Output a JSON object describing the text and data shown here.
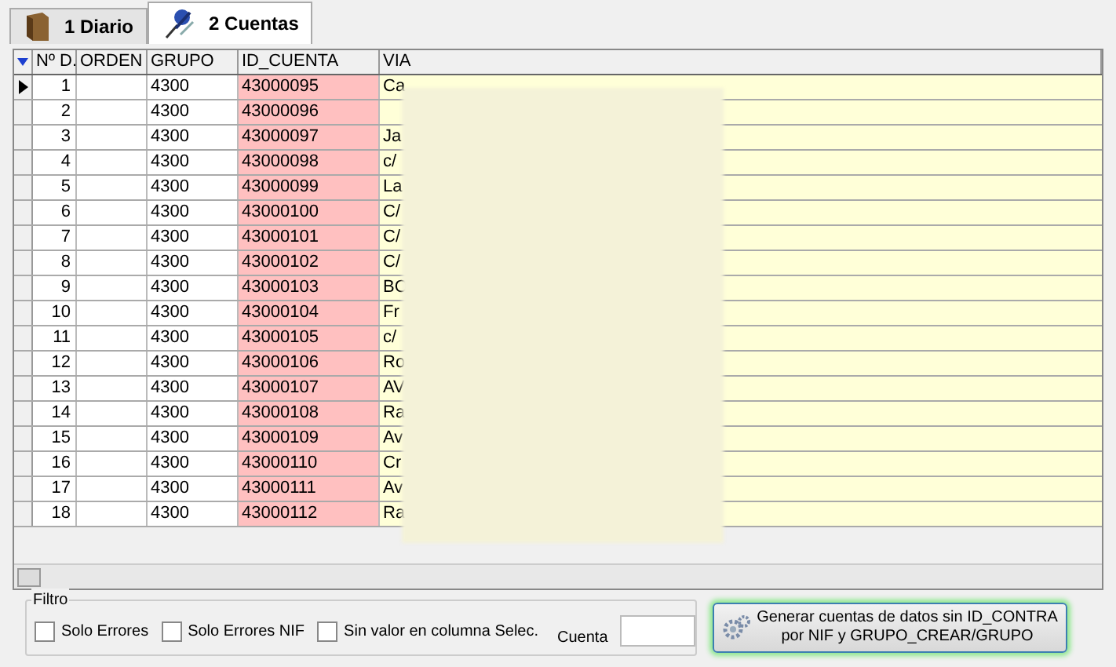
{
  "tabs": [
    {
      "label": "1 Diario",
      "selected": false
    },
    {
      "label": "2 Cuentas",
      "selected": true
    }
  ],
  "table": {
    "columns": [
      "Nº D.",
      "ORDEN",
      "GRUPO",
      "ID_CUENTA",
      "VIA"
    ],
    "rows": [
      {
        "n": "1",
        "grupo": "4300",
        "id_cuenta": "43000095",
        "via": "Ca",
        "current": true
      },
      {
        "n": "2",
        "grupo": "4300",
        "id_cuenta": "43000096",
        "current": false
      },
      {
        "n": "3",
        "grupo": "4300",
        "id_cuenta": "43000097",
        "via": "Ja",
        "current": false
      },
      {
        "n": "4",
        "grupo": "4300",
        "id_cuenta": "43000098",
        "via": "c/",
        "current": false
      },
      {
        "n": "5",
        "grupo": "4300",
        "id_cuenta": "43000099",
        "via": "La",
        "current": false
      },
      {
        "n": "6",
        "grupo": "4300",
        "id_cuenta": "43000100",
        "via": "C/",
        "current": false
      },
      {
        "n": "7",
        "grupo": "4300",
        "id_cuenta": "43000101",
        "via": "C/",
        "current": false
      },
      {
        "n": "8",
        "grupo": "4300",
        "id_cuenta": "43000102",
        "via": "C/",
        "current": false
      },
      {
        "n": "9",
        "grupo": "4300",
        "id_cuenta": "43000103",
        "via": "BO",
        "current": false
      },
      {
        "n": "10",
        "grupo": "4300",
        "id_cuenta": "43000104",
        "via": "Fr",
        "current": false
      },
      {
        "n": "11",
        "grupo": "4300",
        "id_cuenta": "43000105",
        "via": "c/",
        "current": false
      },
      {
        "n": "12",
        "grupo": "4300",
        "id_cuenta": "43000106",
        "via": "Ro",
        "current": false
      },
      {
        "n": "13",
        "grupo": "4300",
        "id_cuenta": "43000107",
        "via": "AV",
        "current": false
      },
      {
        "n": "14",
        "grupo": "4300",
        "id_cuenta": "43000108",
        "via": "Ra",
        "current": false
      },
      {
        "n": "15",
        "grupo": "4300",
        "id_cuenta": "43000109",
        "via": "Av",
        "current": false
      },
      {
        "n": "16",
        "grupo": "4300",
        "id_cuenta": "43000110",
        "via": "Cr",
        "current": false
      },
      {
        "n": "17",
        "grupo": "4300",
        "id_cuenta": "43000111",
        "via": "Av",
        "current": false
      },
      {
        "n": "18",
        "grupo": "4300",
        "id_cuenta": "43000112",
        "via": "Ra",
        "current": false
      }
    ]
  },
  "filter": {
    "title": "Filtro",
    "checkboxes": [
      {
        "label": "Solo Errores",
        "checked": false
      },
      {
        "label": "Solo Errores NIF",
        "checked": false
      },
      {
        "label": "Sin valor en columna Selec.",
        "checked": false
      }
    ],
    "cuenta": {
      "label": "Cuenta"
    }
  },
  "generate_button": {
    "lines": [
      "Generar cuentas de datos sin ID_CONTRA",
      "por NIF y GRUPO_CREAR/GRUPO"
    ]
  }
}
